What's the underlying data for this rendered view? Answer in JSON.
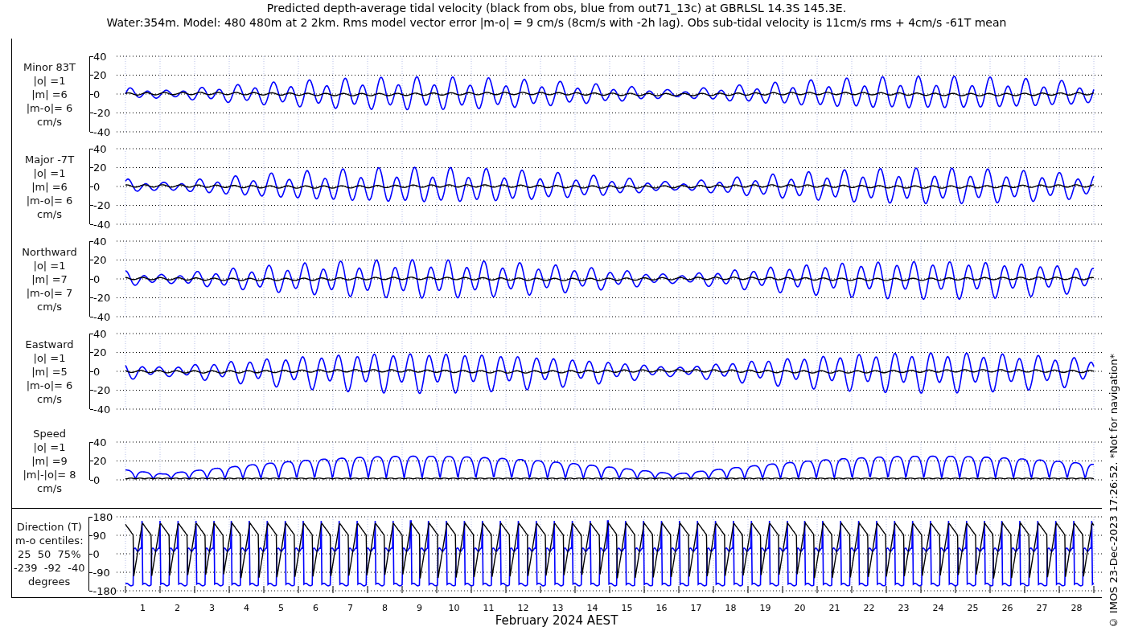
{
  "title_lines": [
    "Predicted depth-average tidal velocity (black from obs, blue from out71_13c) at GBRLSL 14.3S 145.3E.",
    "Water:354m. Model: 480 480m at 2 2km. Rms model vector error |m-o| = 9 cm/s (8cm/s with -2h lag). Obs sub-tidal velocity is 11cm/s rms + 4cm/s -61T mean"
  ],
  "panels": [
    {
      "kind": "signed",
      "labels": [
        "Minor 83T",
        "|o| =1",
        "|m| =6",
        "|m-o|= 6",
        "cm/s"
      ],
      "yticks": [
        "40",
        "20",
        "0",
        "-20",
        "-40"
      ]
    },
    {
      "kind": "signed",
      "labels": [
        "Major -7T",
        "|o| =1",
        "|m| =6",
        "|m-o|= 6",
        "cm/s"
      ],
      "yticks": [
        "40",
        "20",
        "0",
        "-20",
        "-40"
      ]
    },
    {
      "kind": "signed",
      "labels": [
        "Northward",
        "|o| =1",
        "|m| =7",
        "|m-o|= 7",
        "cm/s"
      ],
      "yticks": [
        "40",
        "20",
        "0",
        "-20",
        "-40"
      ]
    },
    {
      "kind": "signed",
      "labels": [
        "Eastward",
        "|o| =1",
        "|m| =5",
        "|m-o|= 6",
        "cm/s"
      ],
      "yticks": [
        "40",
        "20",
        "0",
        "-20",
        "-40"
      ]
    },
    {
      "kind": "speed",
      "labels": [
        "Speed",
        "|o| =1",
        "|m| =9",
        "|m|-|o|= 8",
        "cm/s"
      ],
      "yticks": [
        "40",
        "20",
        "0"
      ]
    }
  ],
  "direction_panel": {
    "kind": "direction",
    "labels": [
      "Direction (T)",
      "m-o centiles:",
      "25  50  75%",
      "-239  -92  -40",
      "degrees"
    ],
    "yticks": [
      "180",
      "90",
      "0",
      "-90",
      "-180"
    ]
  },
  "xticks": [
    "1",
    "2",
    "3",
    "4",
    "5",
    "6",
    "7",
    "8",
    "9",
    "10",
    "11",
    "12",
    "13",
    "14",
    "15",
    "16",
    "17",
    "18",
    "19",
    "20",
    "21",
    "22",
    "23",
    "24",
    "25",
    "26",
    "27",
    "28"
  ],
  "xlabel": "February 2024 AEST",
  "credit": "© IMOS 23-Dec-2023 17:26:52. *Not for navigation*"
}
